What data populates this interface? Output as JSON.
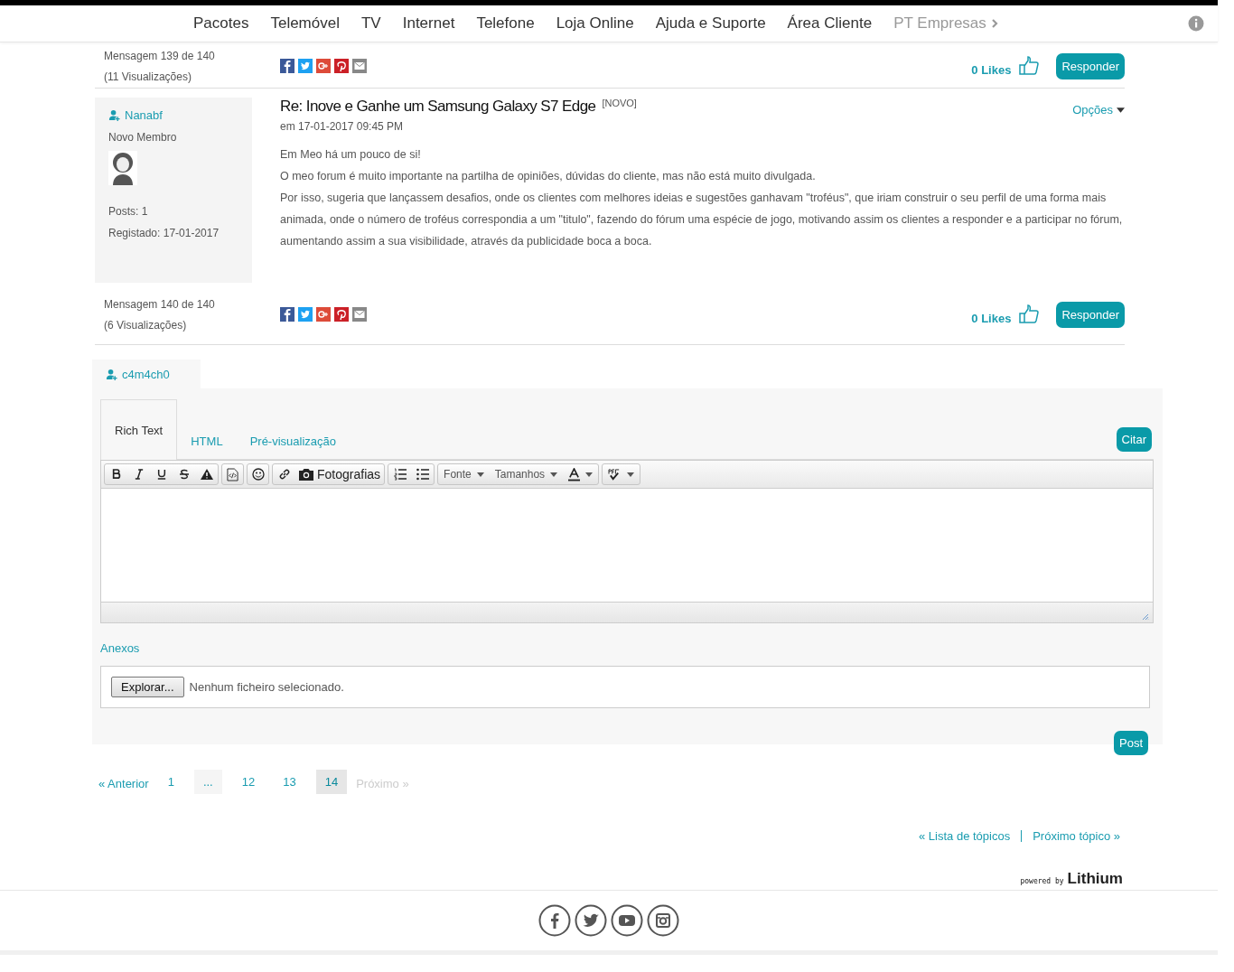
{
  "nav": {
    "items": [
      {
        "label": "Pacotes",
        "muted": false
      },
      {
        "label": "Telemóvel",
        "muted": false
      },
      {
        "label": "TV",
        "muted": false
      },
      {
        "label": "Internet",
        "muted": false
      },
      {
        "label": "Telefone",
        "muted": false
      },
      {
        "label": "Loja Online",
        "muted": false
      },
      {
        "label": "Ajuda e Suporte",
        "muted": false
      },
      {
        "label": "Área Cliente",
        "muted": false
      },
      {
        "label": "PT Empresas",
        "muted": true
      }
    ]
  },
  "previous_post": {
    "message_count": "Mensagem 139 de 140",
    "views": "(11 Visualizações)",
    "likes": "0 Likes",
    "reply": "Responder"
  },
  "post": {
    "author": "Nanabf",
    "rank": "Novo Membro",
    "posts": "Posts: 1",
    "registered": "Registado: 17-01-2017",
    "title": "Re: Inove e Ganhe um Samsung Galaxy S7 Edge",
    "badge": "[NOVO]",
    "date": "em 17-01-2017 09:45 PM",
    "options": "Opções",
    "paragraphs": [
      "Em Meo há um pouco de si!",
      "O meo forum é muito importante na partilha de opiniões, dúvidas do cliente, mas não está muito divulgada.",
      "Por isso, sugeria que lançassem desafios, onde os clientes com melhores ideias e sugestões ganhavam \"troféus\", que iriam construir o seu perfil de uma forma mais animada, onde o número de troféus correspondia a um \"titulo\", fazendo do fórum uma espécie de jogo, motivando assim os clientes a responder e a participar no fórum, aumentando assim a sua visibilidade, através da publicidade boca a boca."
    ],
    "message_count": "Mensagem 140 de 140",
    "views": "(6 Visualizações)",
    "likes": "0 Likes",
    "reply": "Responder"
  },
  "reply_form": {
    "user": "c4m4ch0",
    "tabs": [
      {
        "label": "Rich Text",
        "selected": true
      },
      {
        "label": "HTML",
        "selected": false
      },
      {
        "label": "Pré-visualização",
        "selected": false
      }
    ],
    "quote": "Citar",
    "toolbar": {
      "photos": "Fotografias",
      "font": "Fonte",
      "sizes": "Tamanhos"
    },
    "attachments": "Anexos",
    "browse": "Explorar...",
    "no_file": "Nenhum ficheiro selecionado.",
    "post": "Post"
  },
  "pagination": {
    "previous": {
      "label": "« Anterior",
      "disabled": false
    },
    "pages": [
      {
        "label": "1",
        "selected": false
      },
      {
        "label": "...",
        "selected": false,
        "kind": "gap"
      },
      {
        "label": "12",
        "selected": false
      },
      {
        "label": "13",
        "selected": false
      },
      {
        "label": "14",
        "selected": true
      }
    ],
    "next": {
      "label": "Próximo »",
      "disabled": true
    }
  },
  "topic_links": [
    "« Lista de tópicos",
    "Próximo tópico »"
  ],
  "powered": {
    "by": "powered by",
    "brand": "Lithium"
  }
}
